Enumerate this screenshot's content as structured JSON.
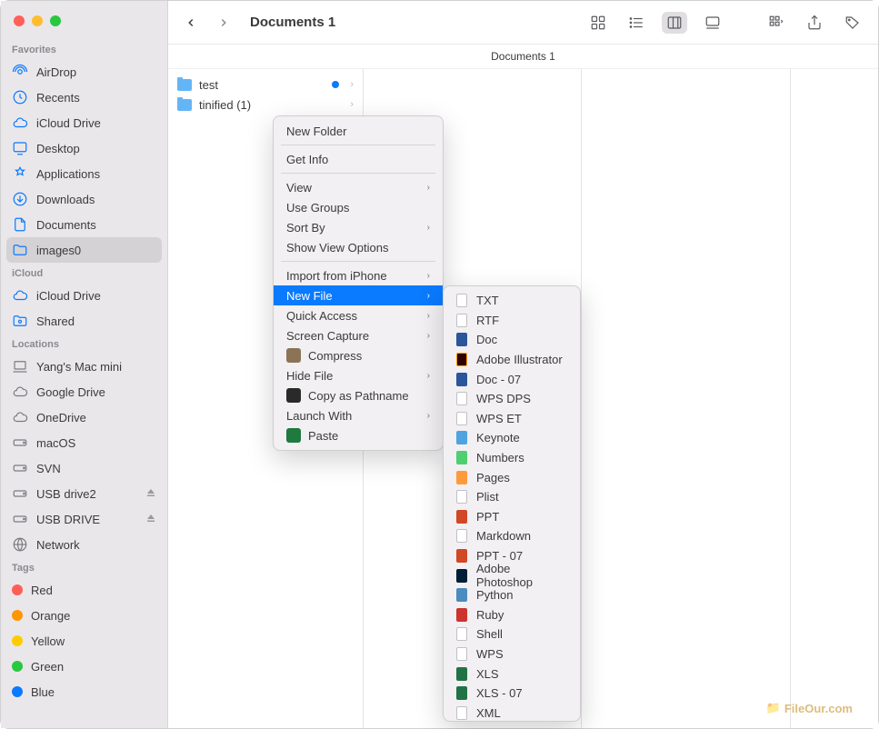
{
  "header": {
    "title": "Documents 1",
    "path_bar": "Documents 1"
  },
  "sidebar": {
    "favorites_label": "Favorites",
    "favorites": [
      {
        "label": "AirDrop",
        "icon": "airdrop"
      },
      {
        "label": "Recents",
        "icon": "clock"
      },
      {
        "label": "iCloud Drive",
        "icon": "cloud"
      },
      {
        "label": "Desktop",
        "icon": "desktop"
      },
      {
        "label": "Applications",
        "icon": "apps"
      },
      {
        "label": "Downloads",
        "icon": "downloads"
      },
      {
        "label": "Documents",
        "icon": "doc"
      },
      {
        "label": "images0",
        "icon": "folder",
        "selected": true
      }
    ],
    "icloud_label": "iCloud",
    "icloud": [
      {
        "label": "iCloud Drive",
        "icon": "cloud"
      },
      {
        "label": "Shared",
        "icon": "shared"
      }
    ],
    "locations_label": "Locations",
    "locations": [
      {
        "label": "Yang's Mac mini",
        "icon": "computer"
      },
      {
        "label": "Google Drive",
        "icon": "cloud"
      },
      {
        "label": "OneDrive",
        "icon": "cloud"
      },
      {
        "label": "macOS",
        "icon": "disk"
      },
      {
        "label": "SVN",
        "icon": "disk"
      },
      {
        "label": "USB drive2",
        "icon": "disk",
        "eject": true
      },
      {
        "label": "USB DRIVE",
        "icon": "disk",
        "eject": true
      },
      {
        "label": "Network",
        "icon": "network"
      }
    ],
    "tags_label": "Tags",
    "tags": [
      {
        "label": "Red",
        "color": "#ff5f57"
      },
      {
        "label": "Orange",
        "color": "#ff9500"
      },
      {
        "label": "Yellow",
        "color": "#ffcc00"
      },
      {
        "label": "Green",
        "color": "#28c840"
      },
      {
        "label": "Blue",
        "color": "#0a7aff"
      }
    ]
  },
  "column1": {
    "items": [
      {
        "name": "test",
        "blue_tag": true
      },
      {
        "name": "tinified (1)"
      }
    ]
  },
  "context_menu": {
    "items": [
      {
        "label": "New Folder"
      },
      {
        "sep": true
      },
      {
        "label": "Get Info"
      },
      {
        "sep": true
      },
      {
        "label": "View",
        "submenu": true
      },
      {
        "label": "Use Groups"
      },
      {
        "label": "Sort By",
        "submenu": true
      },
      {
        "label": "Show View Options"
      },
      {
        "sep": true
      },
      {
        "label": "Import from iPhone",
        "submenu": true
      },
      {
        "label": "New File",
        "submenu": true,
        "highlight": true
      },
      {
        "label": "Quick Access",
        "submenu": true
      },
      {
        "label": "Screen Capture",
        "submenu": true
      },
      {
        "label": "Compress",
        "icon": "compress"
      },
      {
        "label": "Hide File",
        "submenu": true
      },
      {
        "label": "Copy as Pathname",
        "icon": "copypath"
      },
      {
        "label": "Launch With",
        "submenu": true
      },
      {
        "label": "Paste",
        "icon": "paste"
      }
    ]
  },
  "new_file_submenu": [
    {
      "label": "TXT",
      "cls": ""
    },
    {
      "label": "RTF",
      "cls": ""
    },
    {
      "label": "Doc",
      "cls": "blue"
    },
    {
      "label": "Adobe Illustrator",
      "cls": "ai"
    },
    {
      "label": "Doc - 07",
      "cls": "blue"
    },
    {
      "label": "WPS DPS",
      "cls": ""
    },
    {
      "label": "WPS ET",
      "cls": ""
    },
    {
      "label": "Keynote",
      "cls": "key"
    },
    {
      "label": "Numbers",
      "cls": "num"
    },
    {
      "label": "Pages",
      "cls": "pages"
    },
    {
      "label": "Plist",
      "cls": ""
    },
    {
      "label": "PPT",
      "cls": "orange"
    },
    {
      "label": "Markdown",
      "cls": ""
    },
    {
      "label": "PPT - 07",
      "cls": "orange"
    },
    {
      "label": "Adobe Photoshop",
      "cls": "navy"
    },
    {
      "label": "Python",
      "cls": "py"
    },
    {
      "label": "Ruby",
      "cls": "rb"
    },
    {
      "label": "Shell",
      "cls": ""
    },
    {
      "label": "WPS",
      "cls": ""
    },
    {
      "label": "XLS",
      "cls": "green"
    },
    {
      "label": "XLS - 07",
      "cls": "green"
    },
    {
      "label": "XML",
      "cls": ""
    }
  ],
  "watermark": "FileOur.com"
}
